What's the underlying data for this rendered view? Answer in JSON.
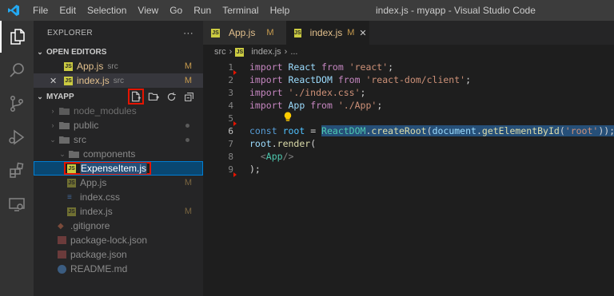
{
  "titlebar": {
    "menu": [
      "File",
      "Edit",
      "Selection",
      "View",
      "Go",
      "Run",
      "Terminal",
      "Help"
    ],
    "title": "index.js - myapp - Visual Studio Code"
  },
  "activity": [
    "explorer-icon",
    "search-icon",
    "source-control-icon",
    "run-debug-icon",
    "extensions-icon",
    "remote-explorer-icon"
  ],
  "sidebar": {
    "header": "EXPLORER",
    "more": "···",
    "open_editors": {
      "label": "OPEN EDITORS",
      "items": [
        {
          "name": "App.js",
          "dir": "src",
          "badge": "M"
        },
        {
          "name": "index.js",
          "dir": "src",
          "badge": "M",
          "close": "✕"
        }
      ]
    },
    "project": {
      "label": "MYAPP",
      "items": [
        {
          "name": "node_modules",
          "type": "folder"
        },
        {
          "name": "public",
          "type": "folder"
        },
        {
          "name": "src",
          "type": "folder"
        },
        {
          "name": "components",
          "type": "folder"
        },
        {
          "name": "ExpenseItem.js",
          "type": "rename"
        },
        {
          "name": "App.js",
          "type": "js",
          "badge": "M"
        },
        {
          "name": "index.css",
          "type": "css"
        },
        {
          "name": "index.js",
          "type": "js",
          "badge": "M"
        },
        {
          "name": ".gitignore",
          "type": "git"
        },
        {
          "name": "package-lock.json",
          "type": "json"
        },
        {
          "name": "package.json",
          "type": "json"
        },
        {
          "name": "README.md",
          "type": "md"
        }
      ]
    }
  },
  "tabs": [
    {
      "name": "App.js",
      "badge": "M"
    },
    {
      "name": "index.js",
      "badge": "M",
      "close": "✕"
    }
  ],
  "breadcrumb": {
    "folder": "src",
    "file": "index.js",
    "more": "..."
  },
  "editor": {
    "line_numbers": [
      "1",
      "2",
      "3",
      "4",
      "5",
      "6",
      "7",
      "8",
      "9"
    ],
    "lines": {
      "l1": {
        "kw": "import",
        "id": "React",
        "from": "from",
        "str": "'react'",
        "end": ";"
      },
      "l2": {
        "kw": "import",
        "id": "ReactDOM",
        "from": "from",
        "str": "'react-dom/client'",
        "end": ";"
      },
      "l3": {
        "kw": "import",
        "str": "'./index.css'",
        "end": ";"
      },
      "l4": {
        "kw": "import",
        "id": "App",
        "from": "from",
        "str": "'./App'",
        "end": ";"
      },
      "l6": {
        "kw": "const",
        "var": "root",
        "eq": " = ",
        "cls": "ReactDOM",
        "dot": ".",
        "fn": "createRoot",
        "open": "(",
        "doc": "document",
        "dot2": ".",
        "fn2": "getElementById",
        "open2": "(",
        "str": "'root'",
        "close": "));"
      },
      "l7": {
        "id": "root",
        "dot": ".",
        "fn": "render",
        "open": "("
      },
      "l8": {
        "tag_open": "<",
        "cls": "App",
        "tag_close": "/>"
      },
      "l9": {
        "close": ");"
      }
    }
  },
  "colors": {
    "accent": "#007acc",
    "highlight_box": "#e51400",
    "modified": "#c79b4e",
    "js_icon": "#cbcb41"
  }
}
